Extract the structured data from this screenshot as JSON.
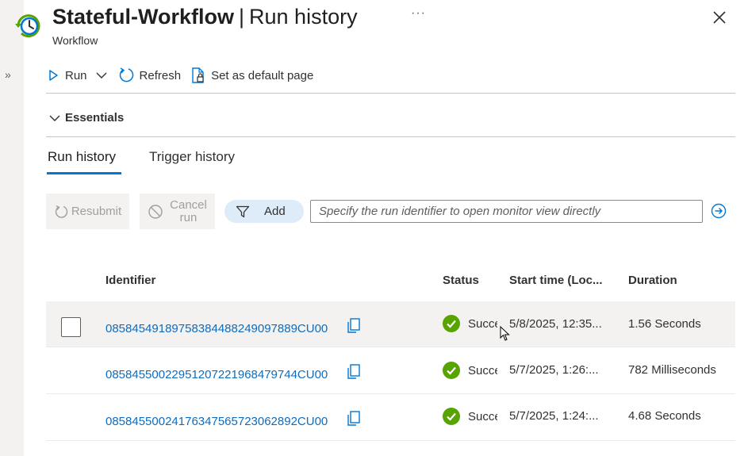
{
  "header": {
    "title_main": "Stateful-Workflow",
    "title_sep": "|",
    "title_page": "Run history",
    "subtitle": "Workflow",
    "more": "···"
  },
  "sidebar": {
    "expand_glyph": "»"
  },
  "toolbar": {
    "run_label": "Run",
    "refresh_label": "Refresh",
    "default_page_label": "Set as default page"
  },
  "essentials": {
    "label": "Essentials"
  },
  "tabs": [
    {
      "label": "Run history",
      "active": true
    },
    {
      "label": "Trigger history",
      "active": false
    }
  ],
  "actions": {
    "resubmit_label": "Resubmit",
    "cancel_label_line1": "Cancel",
    "cancel_label_line2": "run",
    "filter_label": "Add",
    "search_placeholder": "Specify the run identifier to open monitor view directly"
  },
  "table": {
    "columns": {
      "identifier": "Identifier",
      "status": "Status",
      "start_time": "Start time (Loc...",
      "duration": "Duration"
    },
    "rows": [
      {
        "identifier": "08584549189758384488249097889CU00",
        "status": "Succeeded",
        "start_time": "5/8/2025, 12:35...",
        "duration": "1.56 Seconds"
      },
      {
        "identifier": "08584550022951207221968479744CU00",
        "status": "Succeeded",
        "start_time": "5/7/2025, 1:26:...",
        "duration": "782 Milliseconds"
      },
      {
        "identifier": "08584550024176347565723062892CU00",
        "status": "Succeeded",
        "start_time": "5/7/2025, 1:24:...",
        "duration": "4.68 Seconds"
      }
    ]
  },
  "colors": {
    "accent": "#0078d4",
    "link": "#0f6cbd",
    "success": "#57a300",
    "filter_pill": "#deecf9"
  }
}
